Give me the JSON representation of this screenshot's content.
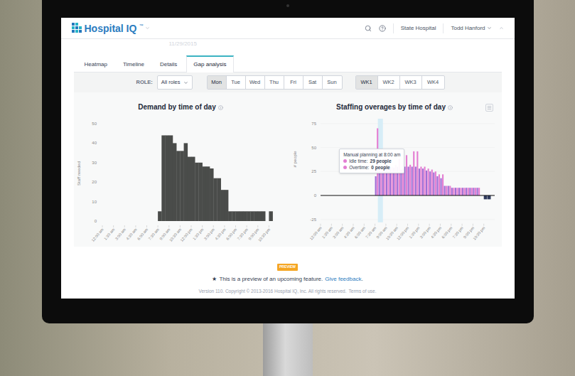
{
  "app": {
    "logo": "Hospital IQ",
    "trademark": "™",
    "facility": "State Hospital",
    "user": "Todd Hanford"
  },
  "date": "11/29/2015",
  "tabs": [
    {
      "label": "Heatmap",
      "selected": false
    },
    {
      "label": "Timeline",
      "selected": false
    },
    {
      "label": "Details",
      "selected": false
    },
    {
      "label": "Gap analysis",
      "selected": true
    }
  ],
  "filters": {
    "role_label": "ROLE:",
    "role_value": "All roles",
    "days": [
      {
        "label": "Mon",
        "selected": true
      },
      {
        "label": "Tue",
        "selected": false
      },
      {
        "label": "Wed",
        "selected": false
      },
      {
        "label": "Thu",
        "selected": false
      },
      {
        "label": "Fri",
        "selected": false
      },
      {
        "label": "Sat",
        "selected": false
      },
      {
        "label": "Sun",
        "selected": false
      }
    ],
    "weeks": [
      {
        "label": "WK1",
        "selected": true
      },
      {
        "label": "WK2",
        "selected": false
      },
      {
        "label": "WK3",
        "selected": false
      },
      {
        "label": "WK4",
        "selected": false
      }
    ]
  },
  "demand_chart": {
    "title": "Demand by time of day",
    "y_label": "Staff needed",
    "y_ticks": [
      "50",
      "40",
      "30",
      "20",
      "10",
      "0"
    ],
    "x_ticks": [
      "12:00 am",
      "1:30 am",
      "3:00 am",
      "4:30 am",
      "6:00 am",
      "7:30 am",
      "9:00 am",
      "10:30 am",
      "12:00 pm",
      "1:30 pm",
      "3:00 pm",
      "4:30 pm",
      "6:00 pm",
      "7:30 pm",
      "9:00 pm",
      "10:30 pm"
    ],
    "color": "#4a4c4a",
    "values": [
      0,
      0,
      0,
      0,
      0,
      0,
      0,
      0,
      0,
      0,
      0,
      0,
      0,
      0,
      0,
      5,
      44,
      44,
      44,
      40,
      36,
      36,
      40,
      33,
      33,
      30,
      30,
      28,
      28,
      27,
      22,
      22,
      16,
      16,
      5,
      5,
      5,
      5,
      5,
      5,
      5,
      5,
      5,
      5,
      0,
      5,
      0,
      0
    ]
  },
  "overage_chart": {
    "title": "Staffing overages by time of day",
    "y_label": "# people",
    "y_ticks": [
      "75",
      "50",
      "25",
      "0",
      "-25"
    ],
    "x_ticks": [
      "12:00 am",
      "1:30 am",
      "3:00 am",
      "4:30 am",
      "6:00 am",
      "7:30 am",
      "9:00 am",
      "10:30 am",
      "12:00 pm",
      "1:30 pm",
      "3:00 pm",
      "4:30 pm",
      "6:00 pm",
      "7:30 pm",
      "9:00 pm",
      "10:30 pm"
    ],
    "series": [
      {
        "kind": "idle",
        "color": "#a06cd5",
        "values": [
          0,
          0,
          0,
          0,
          0,
          0,
          0,
          0,
          0,
          0,
          0,
          0,
          0,
          0,
          0,
          20,
          26,
          27,
          27,
          29,
          29,
          30,
          27,
          30,
          30,
          30,
          30,
          28,
          28,
          26,
          25,
          24,
          20,
          18,
          10,
          10,
          8,
          8,
          8,
          8,
          8,
          8,
          8,
          8,
          0,
          0,
          0,
          0
        ]
      },
      {
        "kind": "idle",
        "color": "#e47fd2",
        "values": [
          0,
          0,
          0,
          0,
          0,
          0,
          0,
          0,
          0,
          0,
          0,
          0,
          0,
          0,
          0,
          70,
          29,
          40,
          28,
          30,
          32,
          38,
          28,
          42,
          32,
          46,
          46,
          30,
          30,
          28,
          27,
          25,
          22,
          22,
          10,
          10,
          8,
          8,
          8,
          8,
          8,
          8,
          8,
          8,
          0,
          0,
          0,
          0
        ]
      },
      {
        "kind": "overtime",
        "color": "#2f3a5c",
        "values": [
          0,
          0,
          0,
          0,
          0,
          0,
          0,
          0,
          0,
          0,
          0,
          0,
          0,
          0,
          0,
          0,
          0,
          0,
          0,
          0,
          0,
          0,
          0,
          0,
          0,
          0,
          0,
          0,
          0,
          0,
          0,
          0,
          0,
          0,
          0,
          0,
          0,
          0,
          0,
          0,
          0,
          0,
          0,
          0,
          0,
          -4,
          -4,
          0
        ]
      }
    ],
    "hover_bin": 16,
    "tooltip": {
      "title": "Manual planning at 8:00 am",
      "rows": [
        {
          "label": "Idle time:",
          "value": "29 people",
          "color": "#e47fd2"
        },
        {
          "label": "Overtime:",
          "value": "0 people",
          "color": "#e47fd2"
        }
      ]
    }
  },
  "footer": {
    "badge": "PREVIEW",
    "star": "★",
    "message": "This is a preview of an upcoming feature.",
    "link": "Give feedback",
    "suffix": ".",
    "version": "Version 110. Copyright © 2013-2016 Hospital IQ, Inc. All rights reserved.",
    "terms": "Terms of use."
  }
}
